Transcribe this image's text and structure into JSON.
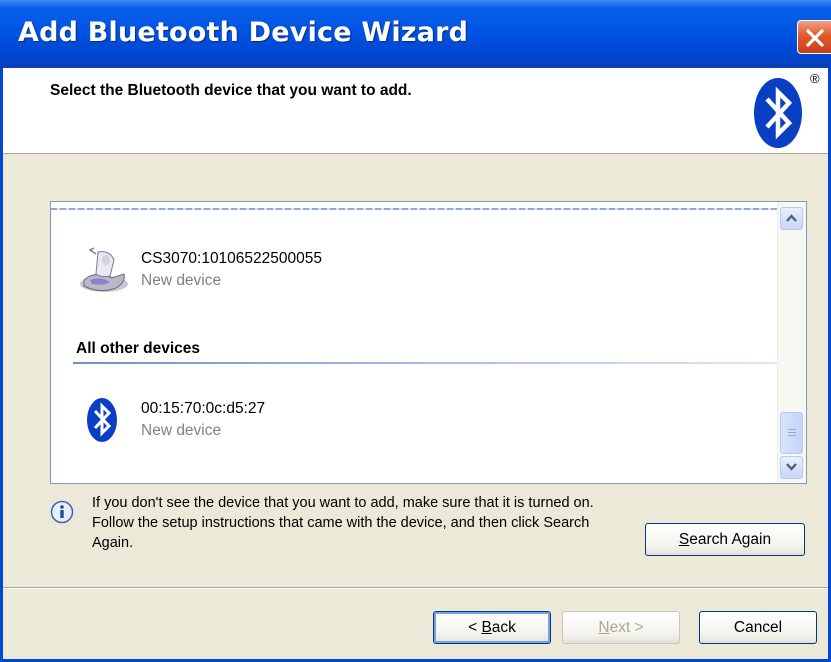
{
  "window": {
    "title": "Add Bluetooth Device Wizard"
  },
  "header": {
    "title": "Select the Bluetooth device that you want to add.",
    "logo_icon": "bluetooth-logo-icon",
    "registered_mark": "®"
  },
  "device_list": {
    "devices": [
      {
        "name": "CS3070:10106522500055",
        "status": "New device",
        "icon": "scanner-device-icon"
      }
    ],
    "other_group": {
      "label": "All other devices",
      "devices": [
        {
          "name": "00:15:70:0c:d5:27",
          "status": "New device",
          "icon": "bluetooth-device-icon"
        }
      ]
    },
    "scroll": {
      "position": 0.85
    }
  },
  "info": {
    "icon": "info-icon",
    "text": "If you don't see the device that you want to add, make sure that it is turned on. Follow the setup instructions that came with the device, and then click Search Again."
  },
  "buttons": {
    "search_again": {
      "accel": "S",
      "rest": "earch Again"
    },
    "back": {
      "prefix": "< ",
      "accel": "B",
      "rest": "ack"
    },
    "next": {
      "accel": "N",
      "rest": "ext >"
    },
    "cancel": "Cancel"
  },
  "colors": {
    "titlebar": "#0054e3",
    "dialog_bg": "#ece9d8",
    "bluetooth_blue": "#0a3fc4",
    "close_red": "#e05a2c"
  }
}
